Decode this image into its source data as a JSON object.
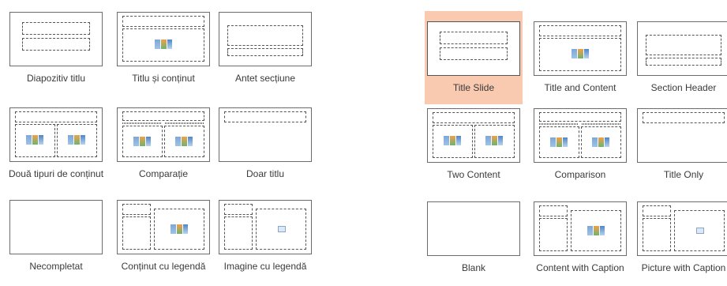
{
  "left_panel": {
    "layouts": [
      {
        "label": "Diapozitiv titlu"
      },
      {
        "label": "Titlu și conținut"
      },
      {
        "label": "Antet secțiune"
      },
      {
        "label": "Două tipuri de conținut"
      },
      {
        "label": "Comparație"
      },
      {
        "label": "Doar titlu"
      },
      {
        "label": "Necompletat"
      },
      {
        "label": "Conținut cu legendă"
      },
      {
        "label": "Imagine cu legendă"
      }
    ]
  },
  "right_panel": {
    "layouts": [
      {
        "label": "Title Slide",
        "selected": true
      },
      {
        "label": "Title and Content"
      },
      {
        "label": "Section Header"
      },
      {
        "label": "Two Content"
      },
      {
        "label": "Comparison"
      },
      {
        "label": "Title Only"
      },
      {
        "label": "Blank"
      },
      {
        "label": "Content with Caption"
      },
      {
        "label": "Picture with Caption"
      }
    ]
  },
  "colors": {
    "selected_background": "#f9c9b0",
    "thumbnail_border": "#6b6b6b"
  }
}
